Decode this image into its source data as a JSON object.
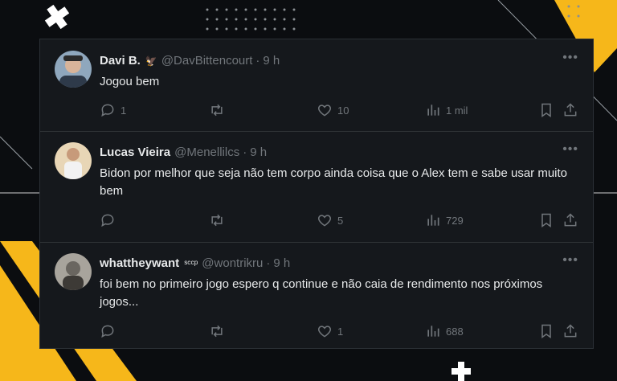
{
  "colors": {
    "background": "#0b0d10",
    "card": "#15181c",
    "accent": "#f6b71a",
    "text": "#e7e9ea",
    "muted": "#71767b"
  },
  "tweets": [
    {
      "name": "Davi B.",
      "badge": "🦅",
      "handle": "@DavBittencourt",
      "time": "9 h",
      "text": "Jogou bem",
      "replies": "1",
      "likes": "10",
      "views": "1 mil"
    },
    {
      "name": "Lucas Vieira",
      "badge": "",
      "handle": "@Menellilcs",
      "time": "9 h",
      "text": "Bidon por melhor que seja não tem corpo ainda coisa que o Alex tem e sabe usar muito bem",
      "replies": "",
      "likes": "5",
      "views": "729"
    },
    {
      "name": "whattheywant",
      "badge": "ˢᶜᶜᵖ",
      "handle": "@wontrikru",
      "time": "9 h",
      "text": "foi bem no primeiro jogo espero q continue e não caia de rendimento nos próximos jogos...",
      "replies": "",
      "likes": "1",
      "views": "688"
    }
  ]
}
